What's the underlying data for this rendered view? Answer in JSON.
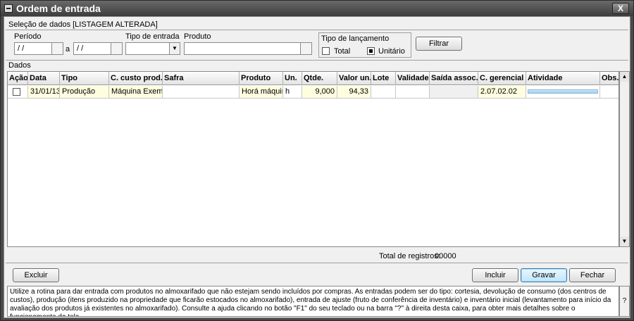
{
  "window": {
    "title": "Ordem de entrada",
    "close": "X"
  },
  "selection": {
    "section_label": "Seleção de dados [LISTAGEM ALTERADA]",
    "periodo_label": "Período",
    "periodo_from": "/ /",
    "periodo_sep": "a",
    "periodo_to": "/ /",
    "tipo_entrada_label": "Tipo de entrada",
    "produto_label": "Produto",
    "tipo_lancamento_label": "Tipo de lançamento",
    "total_label": "Total",
    "unitario_label": "Unitário",
    "total_checked": false,
    "unitario_checked": true,
    "filtrar_label": "Filtrar"
  },
  "dados": {
    "section_label": "Dados",
    "columns": [
      "Ação",
      "Data",
      "Tipo",
      "C. custo prod.",
      "Safra",
      "Produto",
      "Un.",
      "Qtde.",
      "Valor un.",
      "Lote",
      "Validade",
      "Saída assoc.",
      "C. gerencial",
      "Atividade",
      "Obs."
    ],
    "rows": [
      {
        "acao": "",
        "data": "31/01/13",
        "tipo": "Produção",
        "c_custo_prod": "Máquina Exemplo",
        "safra": "",
        "produto": "Horá máquina",
        "un": "h",
        "qtde": "9,000",
        "valor_un": "94,33",
        "lote": "",
        "validade": "",
        "saida_assoc": "",
        "c_gerencial": "2.07.02.02",
        "atividade": "",
        "obs": ""
      }
    ],
    "total_label": "Total de registros:",
    "total_value": "00000"
  },
  "buttons": {
    "excluir": "Excluir",
    "incluir": "Incluir",
    "gravar": "Gravar",
    "fechar": "Fechar"
  },
  "help": {
    "text": "Utilize a rotina para dar entrada com produtos no almoxarifado que não estejam sendo incluídos por compras. As entradas podem ser do tipo: cortesia, devolução de consumo (dos centros de custos), produção (itens produzido na propriedade que ficarão estocados no almoxarifado), entrada de ajuste (fruto de conferência de inventário) e inventário inicial (levantamento para início da avaliação dos produtos já existentes no almoxarifado). Consulte a ajuda clicando no botão \"F1\" do seu teclado ou na barra \"?\" à direita desta caixa, para obter mais detalhes sobre o funcionamento da tela.",
    "question": "?"
  }
}
